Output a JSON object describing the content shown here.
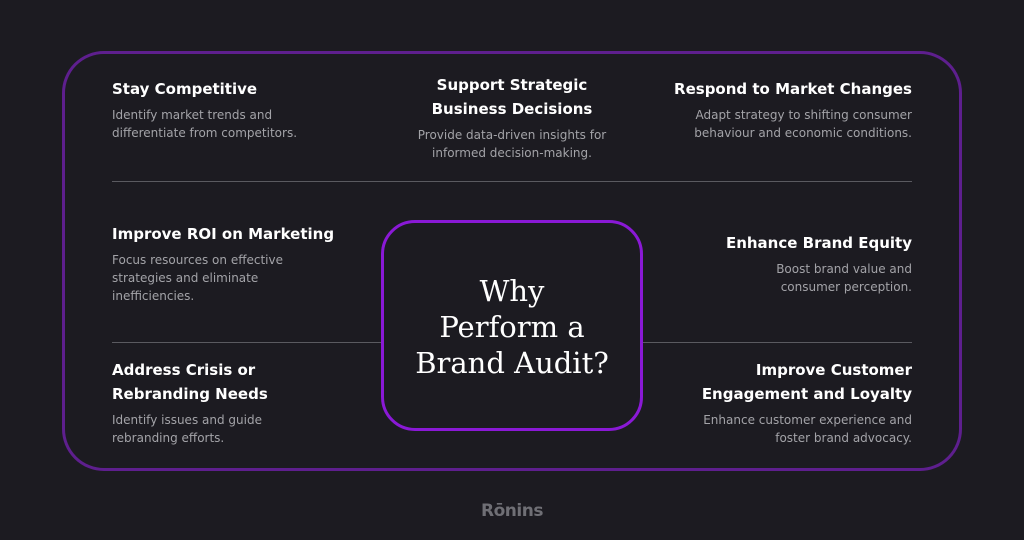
{
  "center": {
    "title": "Why\nPerform a\nBrand Audit?"
  },
  "items": {
    "stay_competitive": {
      "title": "Stay Competitive",
      "description": "Identify market trends and\ndifferentiate from competitors."
    },
    "support_decisions": {
      "title": "Support Strategic\nBusiness Decisions",
      "description": "Provide data-driven insights for\ninformed decision-making."
    },
    "respond_market": {
      "title": "Respond to Market Changes",
      "description": "Adapt strategy to shifting consumer\nbehaviour and economic conditions."
    },
    "improve_roi": {
      "title": "Improve ROI on Marketing",
      "description": "Focus resources on effective\nstrategies and eliminate\ninefficiencies."
    },
    "enhance_equity": {
      "title": "Enhance Brand Equity",
      "description": "Boost brand value and\nconsumer perception."
    },
    "address_crisis": {
      "title": "Address Crisis or\nRebranding Needs",
      "description": "Identify issues and guide\nrebranding efforts."
    },
    "improve_engagement": {
      "title": "Improve Customer\nEngagement and Loyalty",
      "description": "Enhance customer experience and\nfoster brand advocacy."
    }
  },
  "logo": {
    "text": "Rōnins"
  },
  "colors": {
    "background": "#1c1b21",
    "frame_border": "#5e1f8e",
    "center_border": "#8a19d6",
    "divider": "#5a5a60",
    "description_text": "#a3a3a8",
    "logo_text": "#6f6f75"
  }
}
